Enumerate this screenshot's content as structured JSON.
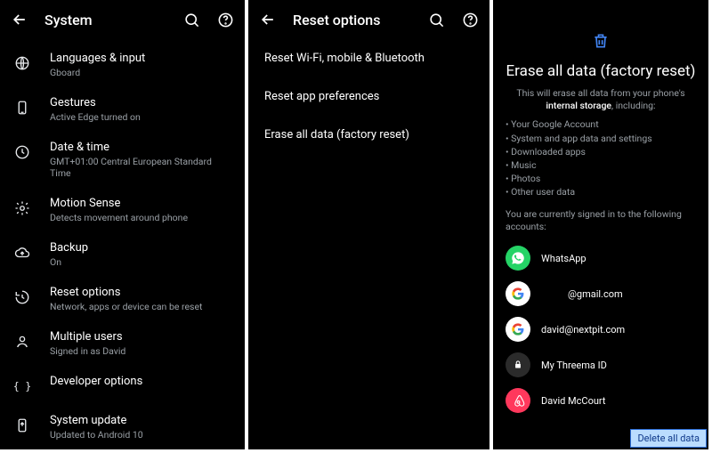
{
  "panel1": {
    "title": "System",
    "items": [
      {
        "icon": "globe-icon",
        "label": "Languages & input",
        "sub": "Gboard"
      },
      {
        "icon": "phone-icon",
        "label": "Gestures",
        "sub": "Active Edge turned on"
      },
      {
        "icon": "clock-icon",
        "label": "Date & time",
        "sub": "GMT+01:00 Central European Standard Time"
      },
      {
        "icon": "gear-icon",
        "label": "Motion Sense",
        "sub": "Detects movement around phone"
      },
      {
        "icon": "cloud-up-icon",
        "label": "Backup",
        "sub": "On"
      },
      {
        "icon": "restore-icon",
        "label": "Reset options",
        "sub": "Network, apps or device can be reset"
      },
      {
        "icon": "person-icon",
        "label": "Multiple users",
        "sub": "Signed in as David"
      },
      {
        "icon": "braces-icon",
        "label": "Developer options",
        "sub": ""
      },
      {
        "icon": "update-icon",
        "label": "System update",
        "sub": "Updated to Android 10"
      }
    ]
  },
  "panel2": {
    "title": "Reset options",
    "items": [
      "Reset Wi-Fi, mobile & Bluetooth",
      "Reset app preferences",
      "Erase all data (factory reset)"
    ]
  },
  "panel3": {
    "title": "Erase all data (factory reset)",
    "sub_lead": "This will erase all data from your phone's",
    "sub_bold": "internal storage",
    "sub_tail": ", including:",
    "bullets": [
      "Your Google Account",
      "System and app data and settings",
      "Downloaded apps",
      "Music",
      "Photos",
      "Other user data"
    ],
    "signed_in": "You are currently signed in to the following accounts:",
    "accounts": [
      {
        "kind": "whatsapp",
        "label": "WhatsApp"
      },
      {
        "kind": "google",
        "label": "           @gmail.com"
      },
      {
        "kind": "google",
        "label": "david@nextpit.com"
      },
      {
        "kind": "threema",
        "label": "My Threema ID"
      },
      {
        "kind": "airbnb",
        "label": "David McCourt"
      }
    ],
    "delete_label": "Delete all data"
  }
}
